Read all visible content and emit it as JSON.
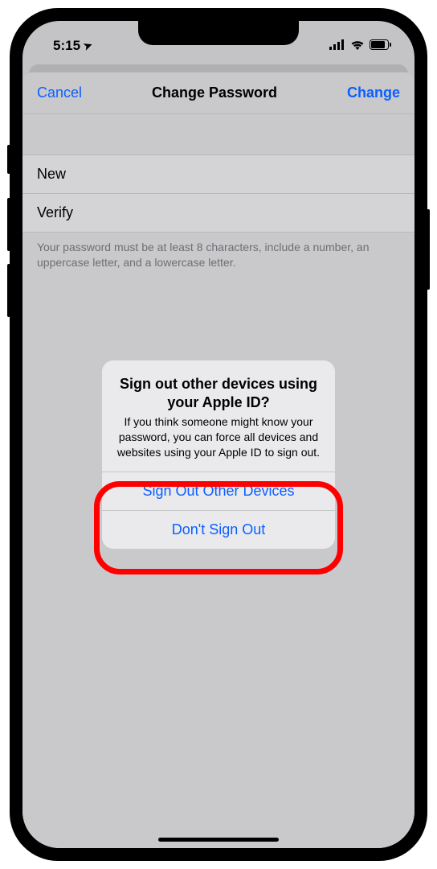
{
  "statusBar": {
    "time": "5:15",
    "locationGlyph": "➤"
  },
  "nav": {
    "cancel": "Cancel",
    "title": "Change Password",
    "change": "Change"
  },
  "fields": {
    "new": "New",
    "verify": "Verify"
  },
  "hint": "Your password must be at least 8 characters, include a number, an uppercase letter, and a lowercase letter.",
  "alert": {
    "title": "Sign out other devices using your Apple ID?",
    "message": "If you think someone might know your password, you can force all devices and websites using your Apple ID to sign out.",
    "signOut": "Sign Out Other Devices",
    "dontSignOut": "Don't Sign Out"
  }
}
